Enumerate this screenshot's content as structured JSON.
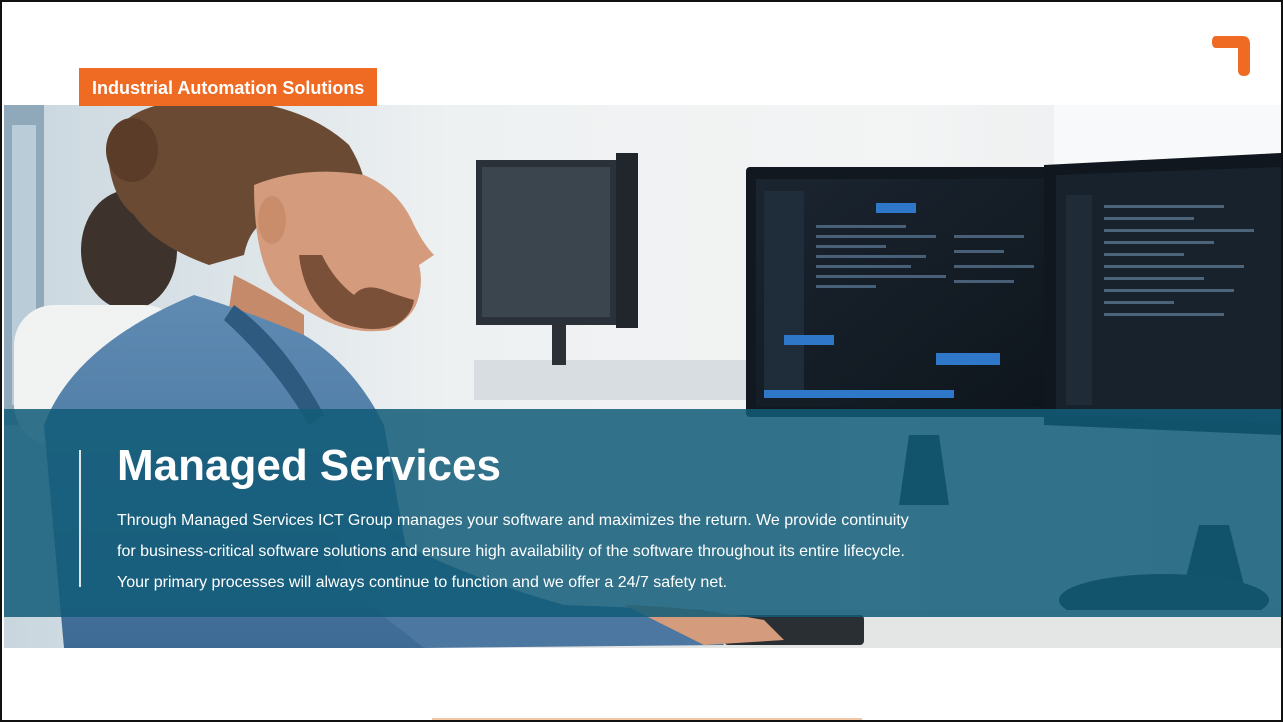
{
  "tag": {
    "label": "Industrial Automation Solutions"
  },
  "brand": {
    "logo": "corner-bracket-icon",
    "accent_color": "#ef6a22"
  },
  "hero": {
    "image": "developer-at-monitors-photo",
    "overlay_color": "#115c78"
  },
  "content": {
    "title": "Managed Services",
    "lines": [
      "Through Managed Services ICT Group manages your software and maximizes the return. We provide continuity",
      "for business-critical software solutions and ensure high availability of the software throughout its entire lifecycle.",
      "Your primary processes will always continue to function and we offer a 24/7 safety net."
    ]
  }
}
